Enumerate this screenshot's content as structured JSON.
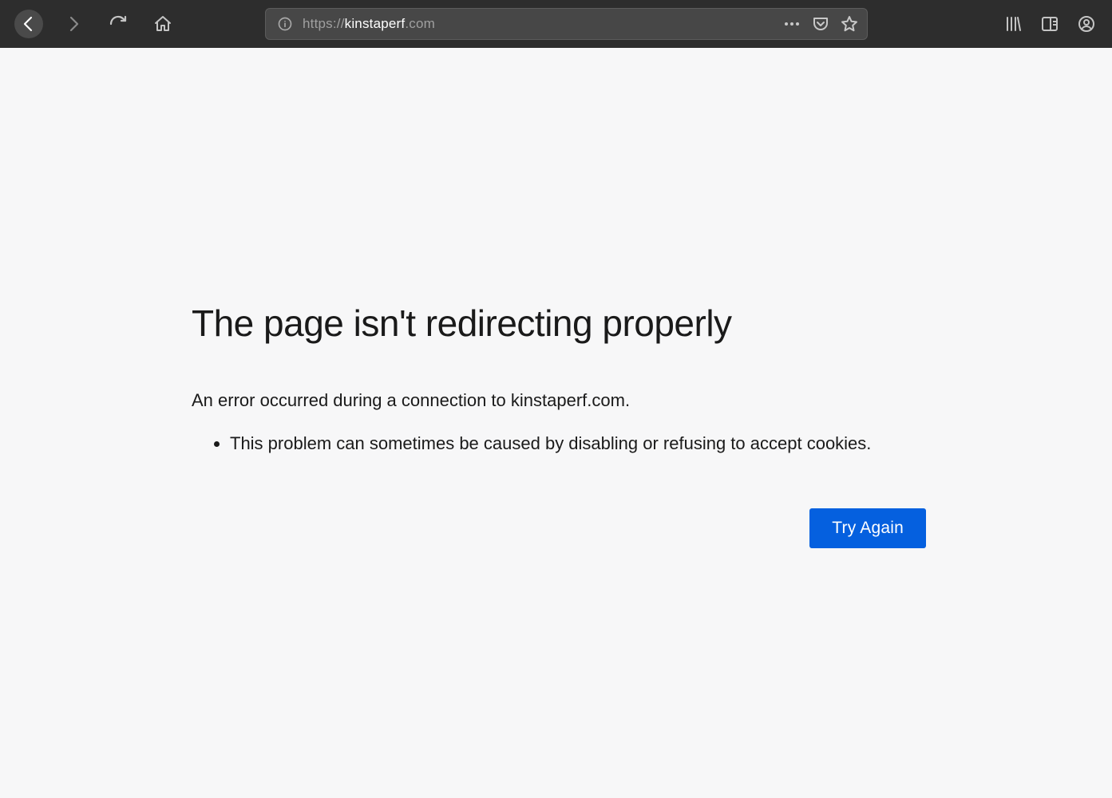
{
  "toolbar": {
    "url_scheme": "https://",
    "url_host": "kinstaperf",
    "url_tld": ".com"
  },
  "error": {
    "title": "The page isn't redirecting properly",
    "message": "An error occurred during a connection to kinstaperf.com.",
    "bullets": [
      "This problem can sometimes be caused by disabling or refusing to accept cookies."
    ],
    "try_again_label": "Try Again"
  }
}
